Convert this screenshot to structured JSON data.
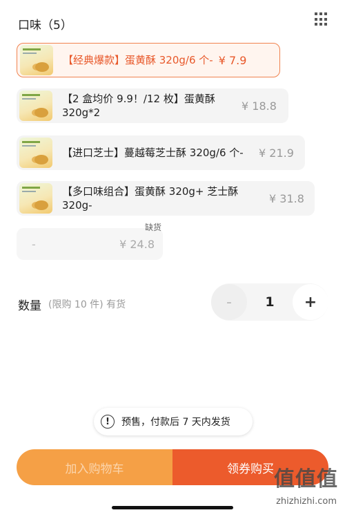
{
  "header": {
    "title": "口味（5）"
  },
  "options": [
    {
      "name": "【经典爆款】蛋黄酥 320g/6 个-",
      "price": "¥ 7.9",
      "selected": true
    },
    {
      "name": "【2 盒均价 9.9！/12 枚】蛋黄酥 320g*2",
      "price": "¥ 18.8"
    },
    {
      "name": "【进口芝士】蔓越莓芝士酥 320g/6 个-",
      "price": "¥ 21.9"
    },
    {
      "name": "【多口味组合】蛋黄酥 320g+ 芝士酥 320g-",
      "price": "¥ 31.8"
    },
    {
      "name": "-",
      "price": "¥ 24.8",
      "out_of_stock_label": "缺货"
    }
  ],
  "quantity": {
    "label": "数量",
    "note": "(限购 10 件) 有货",
    "minus": "-",
    "value": "1",
    "plus": "+"
  },
  "notice": {
    "icon": "!",
    "text": "预售，付款后 7 天内发货"
  },
  "actions": {
    "add_to_cart": "加入购物车",
    "buy": "领券购买"
  },
  "watermark": {
    "main": "值值值",
    "sub": "zhizhizhi.com"
  },
  "colors": {
    "accent": "#ec5b2c",
    "cart": "#f5a046",
    "selected_border": "#f0824e"
  }
}
